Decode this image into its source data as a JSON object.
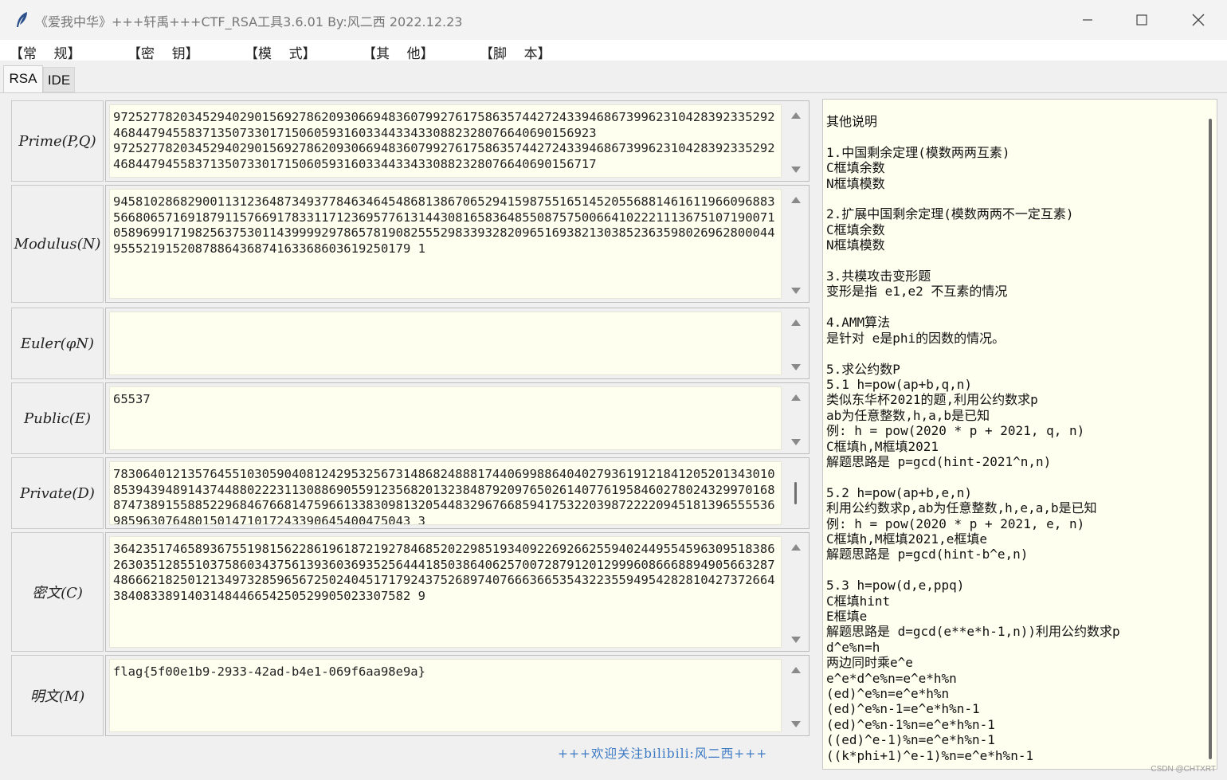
{
  "window": {
    "title": "《爱我中华》+++轩禹+++CTF_RSA工具3.6.01   By:风二西 2022.12.23"
  },
  "menu": [
    "【常    规】",
    "【密    钥】",
    "【模    式】",
    "【其    他】",
    "【脚    本】"
  ],
  "tabs": [
    {
      "label": "RSA",
      "active": true
    },
    {
      "label": "IDE",
      "active": false
    }
  ],
  "fields": {
    "prime": {
      "label": "Prime(P,Q)",
      "value": "9725277820345294029015692786209306694836079927617586357442724339468673996231042839233529246844794558371350733017150605931603344334330882328076640690156923\n9725277820345294029015692786209306694836079927617586357442724339468673996231042839233529246844794558371350733017150605931603344334330882328076640690156717"
    },
    "modulus": {
      "label": "Modulus(N)",
      "value": "9458102868290011312364873493778463464548681386706529415987551651452055688146161196609688356680657169187911576691783311712369577613144308165836485508757500664102221113675107190071058969917198256375301143999929786578190825552983393282096516938213038523635980269628000449555219152087886436874163368603619250179 1"
    },
    "euler": {
      "label": "Euler(φN)",
      "value": ""
    },
    "public": {
      "label": "Public(E)",
      "value": "65537"
    },
    "private": {
      "label": "Private(D)",
      "value": "7830640121357645510305904081242953256731486824888174406998864040279361912184120520134301085394394891437448802223113088690559123568201323848792097650261407761958460278024329970168874738915588522968467668147596613383098132054483296766859417532203987222209451813965555369859630764801501471017243390645400475043 3"
    },
    "cipher": {
      "label": "密文(C)",
      "value": "3642351746589367551981562286196187219278468520229851934092269266255940244955459630951838626303512855103758603437561393603693525644418503864062570072879120129996086668894905663287486662182501213497328596567250240451717924375268974076663665354322355949542828104273726643840833891403148446654250529905023307582 9"
    },
    "plain": {
      "label": "明文(M)",
      "value": "flag{5f00e1b9-2933-42ad-b4e1-069f6aa98e9a}"
    }
  },
  "notes": "其他说明\n\n1.中国剩余定理(模数两两互素)\nC框填余数\nN框填模数\n\n2.扩展中国剩余定理(模数两两不一定互素)\nC框填余数\nN框填模数\n\n3.共模攻击变形题\n变形是指 e1,e2 不互素的情况\n\n4.AMM算法\n是针对 e是phi的因数的情况。\n\n5.求公约数P\n5.1 h=pow(ap+b,q,n)\n类似东华杯2021的题,利用公约数求p\nab为任意整数,h,a,b是已知\n例: h = pow(2020 * p + 2021, q, n)\nC框填h,M框填2021\n解题思路是 p=gcd(hint-2021^n,n)\n\n5.2 h=pow(ap+b,e,n)\n利用公约数求p,ab为任意整数,h,e,a,b是已知\n例: h = pow(2020 * p + 2021, e, n)\nC框填h,M框填2021,e框填e\n解题思路是 p=gcd(hint-b^e,n)\n\n5.3 h=pow(d,e,ppq)\nC框填hint\nE框填e\n解题思路是 d=gcd(e**e*h-1,n))利用公约数求p\nd^e%n=h\n两边同时乘e^e\ne^e*d^e%n=e^e*h%n\n(ed)^e%n=e^e*h%n\n(ed)^e%n-1=e^e*h%n-1\n(ed)^e%n-1%n=e^e*h%n-1\n((ed)^e-1)%n=e^e*h%n-1\n((k*phi+1)^e-1)%n=e^e*h%n-1",
  "footer": "+++欢迎关注bilibili:风二西+++",
  "watermark": "CSDN @CHTXRT"
}
